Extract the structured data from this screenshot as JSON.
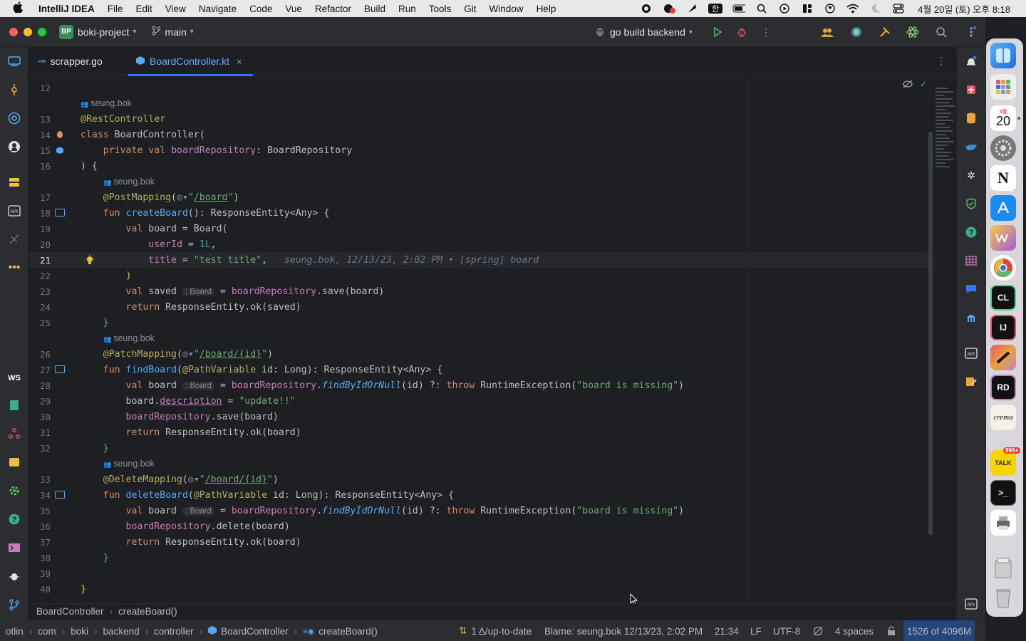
{
  "menubar": {
    "apple": "",
    "items": [
      "IntelliJ IDEA",
      "File",
      "Edit",
      "View",
      "Navigate",
      "Code",
      "Vue",
      "Refactor",
      "Build",
      "Run",
      "Tools",
      "Git",
      "Window",
      "Help"
    ],
    "input_method": "한",
    "clock": "4월 20일 (토) 오후 8:18"
  },
  "titlebar": {
    "project_badge": "BP",
    "project_name": "boki-project",
    "branch": "main",
    "run_config": "go build backend"
  },
  "tabs": [
    {
      "label": "scrapper.go",
      "active": false
    },
    {
      "label": "BoardController.kt",
      "active": true,
      "close": "×"
    }
  ],
  "editor": {
    "author": "seung.bok",
    "inline_blame": "seung.bok, 12/13/23, 2:02 PM • [spring] board",
    "type_hint": ": Board",
    "lines": {
      "12": "12",
      "13": "13",
      "14": "14",
      "15": "15",
      "16": "16",
      "17": "17",
      "18": "18",
      "19": "19",
      "20": "20",
      "21": "21",
      "22": "22",
      "23": "23",
      "24": "24",
      "25": "25",
      "26": "26",
      "27": "27",
      "28": "28",
      "29": "29",
      "30": "30",
      "31": "31",
      "32": "32",
      "33": "33",
      "34": "34",
      "35": "35",
      "36": "36",
      "37": "37",
      "38": "38",
      "39": "39",
      "40": "40"
    }
  },
  "breadcrumbs": [
    "BoardController",
    "createBoard()"
  ],
  "statusbar": {
    "path": [
      "otlin",
      "com",
      "boki",
      "backend",
      "controller",
      "BoardController",
      "createBoard()"
    ],
    "vcs": "1 Δ/up-to-date",
    "blame": "Blame: seung.bok 12/13/23, 2:02 PM",
    "position": "21:34",
    "line_sep": "LF",
    "encoding": "UTF-8",
    "indent": "4 spaces",
    "memory": "1526 of 4096M"
  },
  "dock": {
    "calendar_month": "4월",
    "calendar_day": "20",
    "talk_badge": "999+",
    "crema": "crema"
  },
  "colors": {
    "accent": "#3574f0",
    "editor_bg": "#1e1f22",
    "panel_bg": "#2b2d30"
  }
}
